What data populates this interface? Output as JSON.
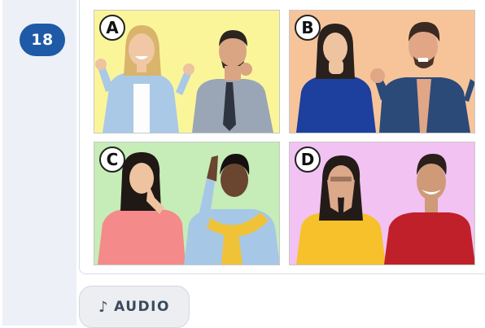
{
  "question": {
    "number": "18"
  },
  "options": [
    {
      "letter": "A",
      "background": "#fbf59a"
    },
    {
      "letter": "B",
      "background": "#f7c49a"
    },
    {
      "letter": "C",
      "background": "#c6ecb8"
    },
    {
      "letter": "D",
      "background": "#f2c2f2"
    }
  ],
  "audio": {
    "icon": "♪",
    "label": "AUDIO"
  }
}
